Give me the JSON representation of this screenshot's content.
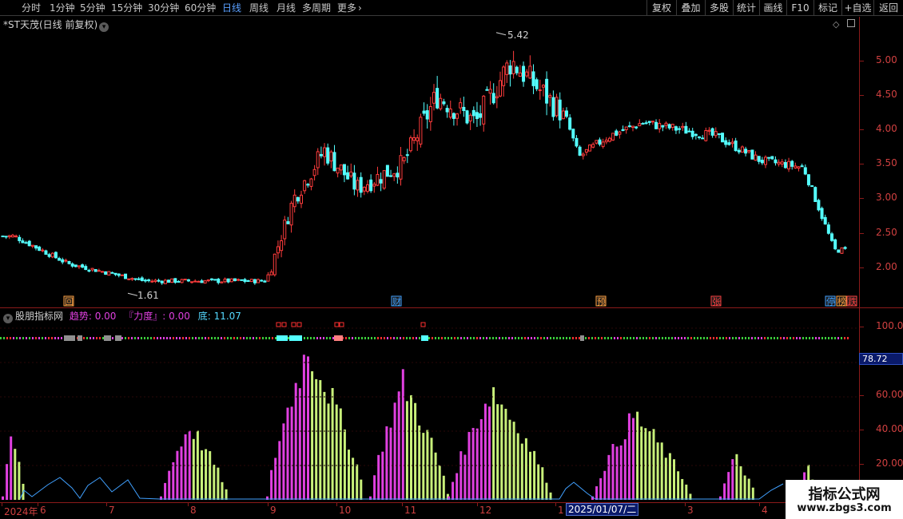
{
  "toolbar": {
    "periods": [
      "分时",
      "1分钟",
      "5分钟",
      "15分钟",
      "30分钟",
      "60分钟",
      "日线",
      "周线",
      "月线",
      "多周期",
      "更多"
    ],
    "active_period": "日线",
    "more_arrow": "chevron-right-icon",
    "right_buttons": [
      "复权",
      "叠加",
      "多股",
      "统计",
      "画线",
      "F10",
      "标记",
      "+自选",
      "返回"
    ]
  },
  "main_chart": {
    "title": "*ST天茂(日线 前复权)",
    "title_icon": "chevron-down-icon",
    "high_label": "5.42",
    "low_label": "1.61",
    "y_ticks": [
      "5.00",
      "4.50",
      "4.00",
      "3.50",
      "3.00",
      "2.50",
      "2.00"
    ],
    "markers": [
      {
        "text": "回",
        "color": "#ffa040"
      },
      {
        "text": "财",
        "color": "#40a0ff"
      },
      {
        "text": "预",
        "color": "#ffa040"
      },
      {
        "text": "张",
        "color": "#ff4040"
      },
      {
        "text": "停",
        "color": "#40a0ff"
      },
      {
        "text": "榜",
        "color": "#ffa040"
      },
      {
        "text": "跌",
        "color": "#ff4040"
      }
    ]
  },
  "indicator": {
    "name": "股朋指标网",
    "trend_label": "趋势",
    "trend_value": "0.00",
    "power_label": "『力度』",
    "power_value": "0.00",
    "bottom_label": "底",
    "bottom_value": "11.07",
    "y_ticks": [
      "100.0",
      "60.00",
      "40.00",
      "20.00"
    ],
    "current_value": "78.72"
  },
  "x_axis": {
    "labels": [
      "2024年",
      "6",
      "7",
      "8",
      "9",
      "10",
      "11",
      "12",
      "1",
      "2",
      "3",
      "4"
    ],
    "cursor_date": "2025/01/07/二"
  },
  "watermark": {
    "title": "指标公式网",
    "url": "www.zbgs3.com"
  },
  "colors": {
    "up": "#ff3c3c",
    "down": "#54ffff",
    "axis": "#8b1a1a",
    "magenta": "#e040e0",
    "lightgreen": "#c8f07a",
    "line": "#40a0ff"
  },
  "chart_data": {
    "type": "candlestick",
    "title": "*ST天茂(日线 前复权)",
    "ylim": [
      1.5,
      5.6
    ],
    "high": 5.42,
    "low": 1.61,
    "close_path": [
      {
        "date": "2024-05",
        "close": 2.45
      },
      {
        "date": "2024-06",
        "close": 2.05
      },
      {
        "date": "2024-07",
        "close": 1.8
      },
      {
        "date": "2024-08",
        "close": 1.8
      },
      {
        "date": "2024-09-01",
        "close": 1.8
      },
      {
        "date": "2024-09-15",
        "close": 3.0
      },
      {
        "date": "2024-10-01",
        "close": 3.7
      },
      {
        "date": "2024-10-15",
        "close": 3.15
      },
      {
        "date": "2024-11-01",
        "close": 3.5
      },
      {
        "date": "2024-11-15",
        "close": 4.5
      },
      {
        "date": "2024-12-01",
        "close": 4.1
      },
      {
        "date": "2024-12-15",
        "close": 5.0
      },
      {
        "date": "2025-01-07",
        "close": 4.2
      },
      {
        "date": "2025-01-15",
        "close": 3.6
      },
      {
        "date": "2025-02-01",
        "close": 3.9
      },
      {
        "date": "2025-02-15",
        "close": 4.1
      },
      {
        "date": "2025-03-01",
        "close": 4.0
      },
      {
        "date": "2025-03-15",
        "close": 3.9
      },
      {
        "date": "2025-04-01",
        "close": 3.55
      },
      {
        "date": "2025-04-15",
        "close": 3.45
      },
      {
        "date": "2025-04-25",
        "close": 2.25
      }
    ],
    "indicator_ylim": [
      0,
      110
    ],
    "indicator_wave_peaks": [
      {
        "month": "2024-05",
        "value": 38
      },
      {
        "month": "2024-08",
        "value": 43
      },
      {
        "month": "2024-09",
        "value": 88
      },
      {
        "month": "2024-10",
        "value": 62
      },
      {
        "month": "2024-11",
        "value": 68
      },
      {
        "month": "2024-12",
        "value": 64
      },
      {
        "month": "2025-02",
        "value": 49
      },
      {
        "month": "2025-03",
        "value": 25
      },
      {
        "month": "2025-04",
        "value": 23
      }
    ]
  }
}
